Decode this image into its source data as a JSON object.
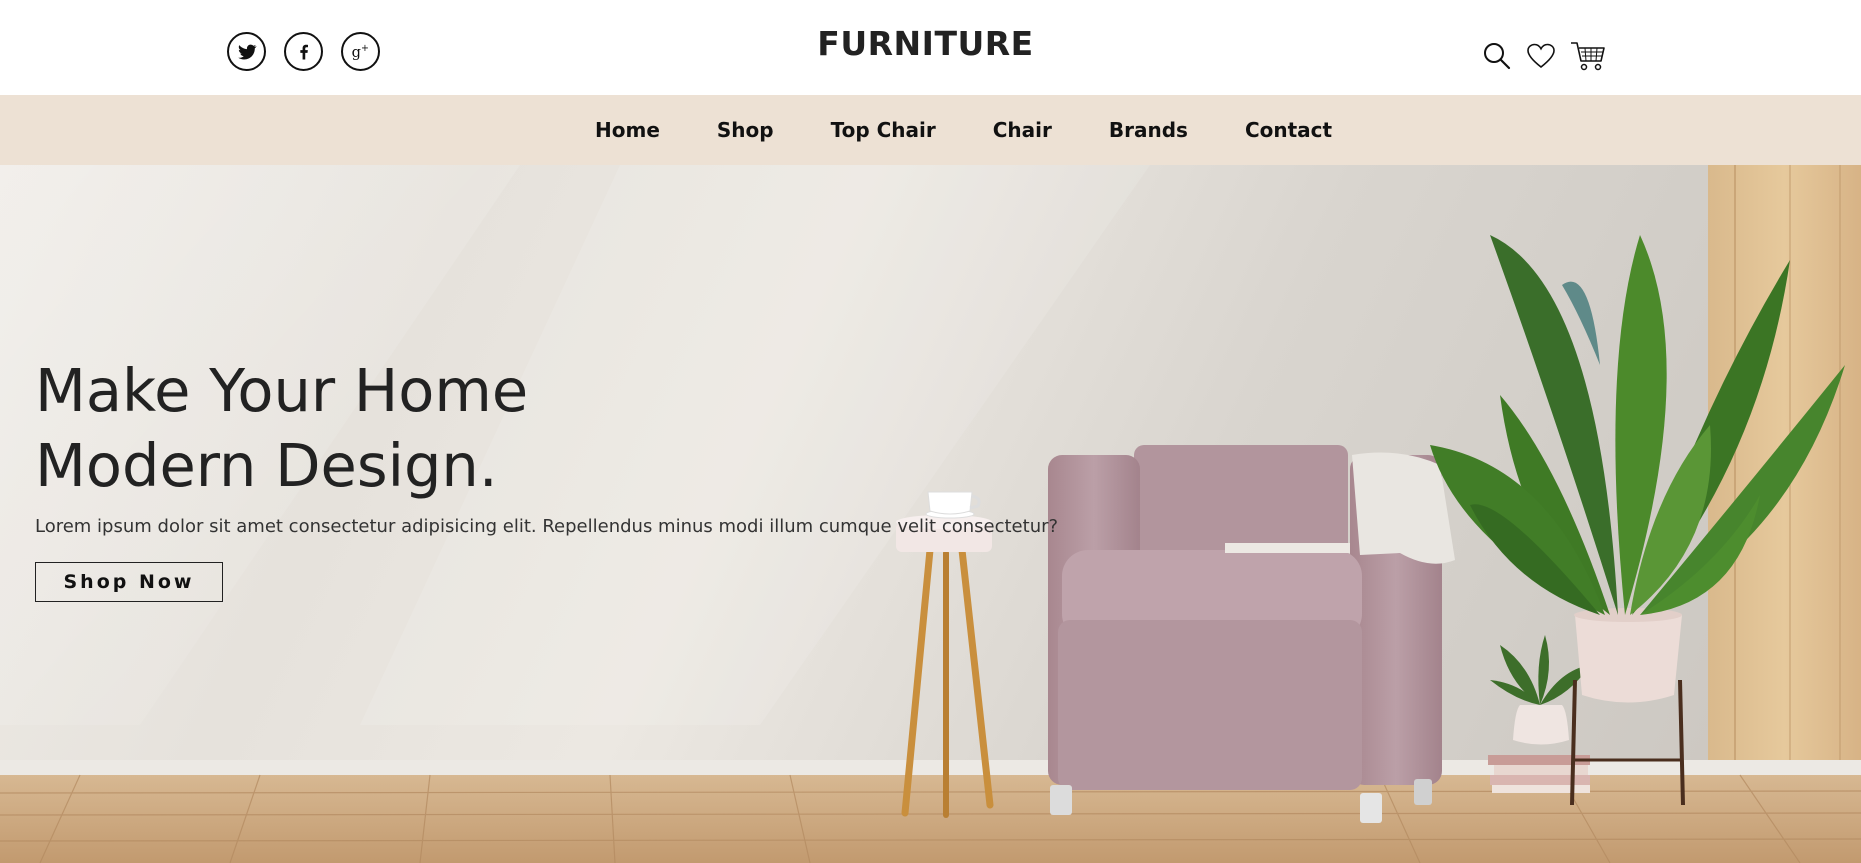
{
  "header": {
    "brand": "FURNITURE",
    "social_links": [
      {
        "name": "twitter-icon"
      },
      {
        "name": "facebook-icon"
      },
      {
        "name": "google-plus-icon"
      }
    ],
    "action_icons": [
      "search-icon",
      "heart-icon",
      "cart-icon"
    ]
  },
  "nav": {
    "items": [
      {
        "label": "Home"
      },
      {
        "label": "Shop"
      },
      {
        "label": "Top Chair"
      },
      {
        "label": "Chair"
      },
      {
        "label": "Brands"
      },
      {
        "label": "Contact"
      }
    ]
  },
  "hero": {
    "headline_line1": "Make Your Home",
    "headline_line2": "Modern Design.",
    "subtext": "Lorem ipsum dolor sit amet consectetur adipisicing elit. Repellendus minus modi illum cumque velit consectetur?",
    "cta_label": "Shop Now"
  },
  "colors": {
    "nav_background": "#ede1d4",
    "text_dark": "#222222",
    "armchair": "#b69aa3",
    "plant_green": "#3e7a2a",
    "floor_wood": "#c9a57c"
  }
}
